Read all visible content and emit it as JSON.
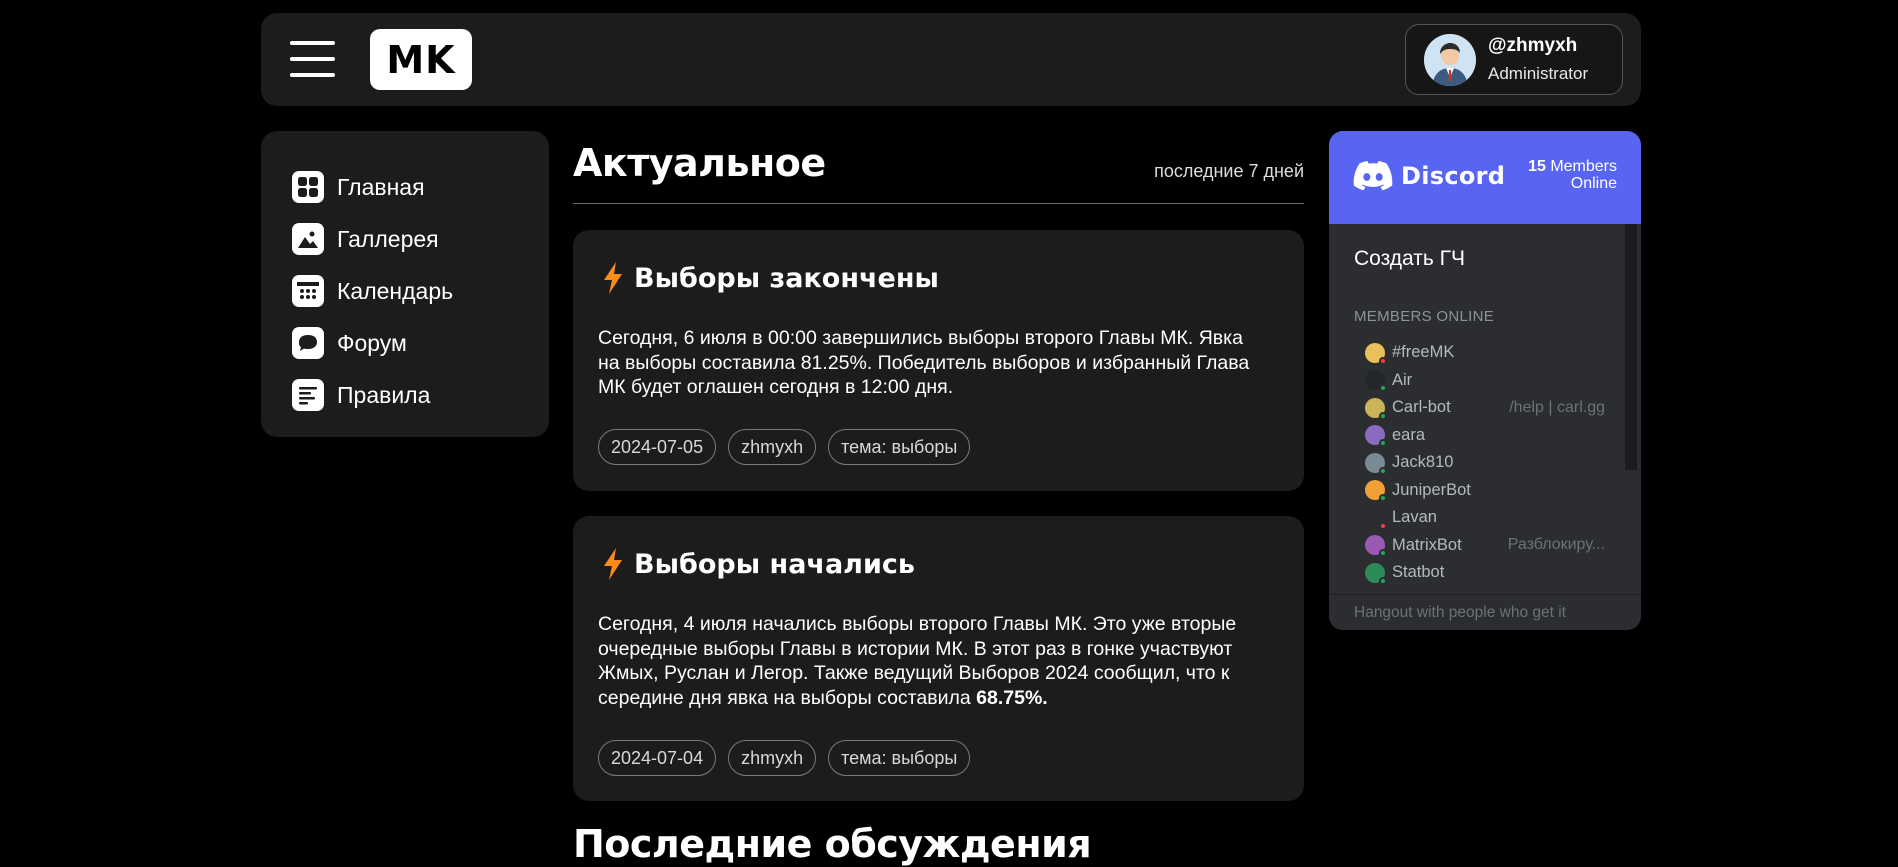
{
  "header": {
    "logo": "MK",
    "user": {
      "name": "@zhmyxh",
      "role": "Administrator"
    }
  },
  "sidebar": {
    "items": [
      {
        "label": "Главная",
        "icon": "home-grid-icon"
      },
      {
        "label": "Галлерея",
        "icon": "gallery-image-icon"
      },
      {
        "label": "Календарь",
        "icon": "calendar-icon"
      },
      {
        "label": "Форум",
        "icon": "forum-chat-icon"
      },
      {
        "label": "Правила",
        "icon": "rules-document-icon"
      }
    ]
  },
  "main": {
    "section_title": "Актуальное",
    "period": "последние 7 дней",
    "posts": [
      {
        "title": "Выборы закончены",
        "body": "Сегодня, 6 июля в 00:00 завершились выборы второго Главы МК. Явка на выборы составила 81.25%. Победитель выборов и избранный Глава МК будет оглашен сегодня в 12:00 дня.",
        "tags": [
          "2024-07-05",
          "zhmyxh",
          "тема: выборы"
        ]
      },
      {
        "title": "Выборы начались",
        "body": "Сегодня, 4 июля начались выборы второго Главы МК. Это уже вторые очередные выборы Главы в истории МК. В этот раз в гонке участвуют Жмых, Руслан и Легор. Также ведущий Выборов 2024 сообщил, что к середине дня явка на выборы составила",
        "body_bold": "68.75%.",
        "tags": [
          "2024-07-04",
          "zhmyxh",
          "тема: выборы"
        ]
      }
    ],
    "section_title_2": "Последние обсуждения"
  },
  "discord": {
    "brand": "Discord",
    "members_count": "15",
    "members_label_1": "Members",
    "members_label_2": "Online",
    "channel": "Создать ГЧ",
    "members_title": "MEMBERS ONLINE",
    "members": [
      {
        "name": "#freeMK",
        "activity": "",
        "color": "#e8c15a",
        "status": "#f23f43"
      },
      {
        "name": "Air",
        "activity": "",
        "color": "#23272a",
        "status": "#23a55a"
      },
      {
        "name": "Carl-bot",
        "activity": "/help | carl.gg",
        "color": "#c9b35b",
        "status": "#23a55a"
      },
      {
        "name": "eara",
        "activity": "",
        "color": "#8a6bbf",
        "status": "#23a55a"
      },
      {
        "name": "Jack810",
        "activity": "",
        "color": "#7a8a95",
        "status": "#23a55a"
      },
      {
        "name": "JuniperBot",
        "activity": "",
        "color": "#f0a036",
        "status": "#23a55a"
      },
      {
        "name": "Lavan",
        "activity": "",
        "color": "#2b2d31",
        "status": "#f23f43"
      },
      {
        "name": "MatrixBot",
        "activity": "Разблокиру...",
        "color": "#9b59b6",
        "status": "#23a55a"
      },
      {
        "name": "Statbot",
        "activity": "",
        "color": "#2e8b57",
        "status": "#23a55a"
      }
    ],
    "footer": "Hangout with people who get it",
    "accent": "#5865f2"
  },
  "colors": {
    "bolt": "#ff8c1a",
    "panel": "#1c1c1c"
  }
}
